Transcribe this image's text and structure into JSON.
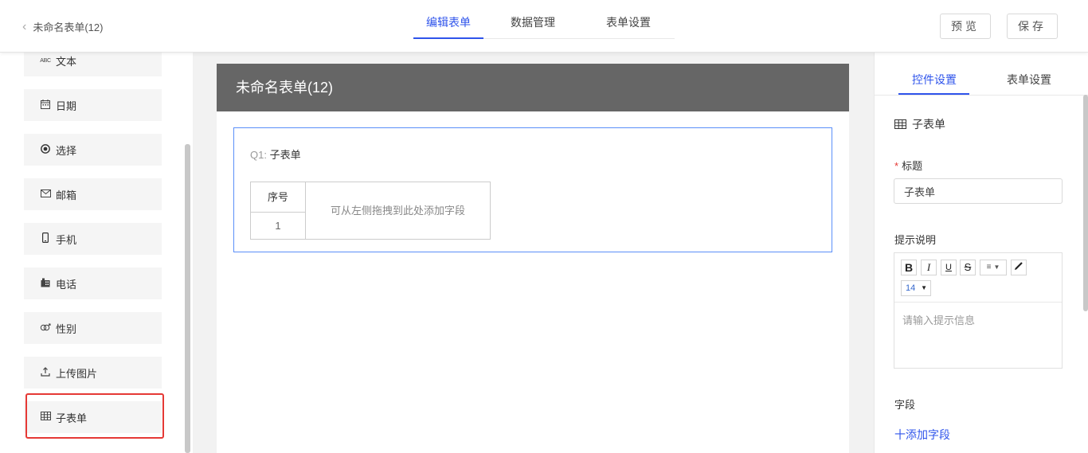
{
  "header": {
    "back_label": "未命名表单(12)",
    "tabs": [
      {
        "label": "编辑表单",
        "active": true
      },
      {
        "label": "数据管理",
        "active": false
      },
      {
        "label": "表单设置",
        "active": false
      }
    ],
    "preview_label": "预览",
    "save_label": "保存"
  },
  "fields": [
    {
      "label": "文本",
      "icon": "text-abc-icon"
    },
    {
      "label": "日期",
      "icon": "calendar-icon"
    },
    {
      "label": "选择",
      "icon": "radio-icon"
    },
    {
      "label": "邮箱",
      "icon": "envelope-icon"
    },
    {
      "label": "手机",
      "icon": "mobile-phone-icon"
    },
    {
      "label": "电话",
      "icon": "telephone-icon"
    },
    {
      "label": "性别",
      "icon": "gender-icon"
    },
    {
      "label": "上传图片",
      "icon": "upload-icon"
    },
    {
      "label": "子表单",
      "icon": "table-grid-icon"
    }
  ],
  "canvas": {
    "form_title": "未命名表单(12)",
    "question_number": "Q1:",
    "question_label": "子表单",
    "table_header": "序号",
    "row_index": "1",
    "drop_hint": "可从左侧拖拽到此处添加字段"
  },
  "settings": {
    "tab_control": "控件设置",
    "tab_form": "表单设置",
    "control_name": "子表单",
    "title_label": "标题",
    "title_required_mark": "*",
    "title_value": "子表单",
    "hint_label": "提示说明",
    "editor": {
      "bold": "B",
      "italic": "I",
      "underline": "U",
      "strike": "S",
      "font_size": "14",
      "placeholder": "请输入提示信息"
    },
    "fields_label": "字段",
    "add_field": "十添加字段"
  },
  "colors": {
    "accent": "#2f54eb",
    "form_header": "#666666",
    "highlight": "#e53935"
  }
}
